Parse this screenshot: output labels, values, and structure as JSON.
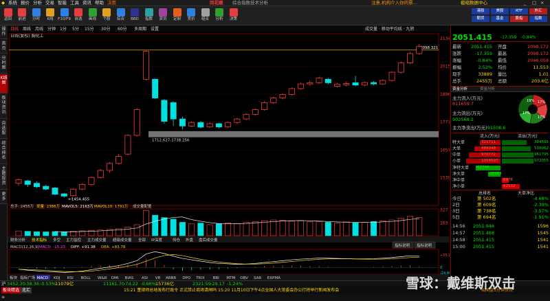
{
  "menu": [
    "系统",
    "报价",
    "分析",
    "交易",
    "智能",
    "工具",
    "资讯",
    "帮助",
    "决策"
  ],
  "menu_center": "综合指数技术分析",
  "menu_right": "注意,机构介入你的票...",
  "menu_right2": "截缩数据中心",
  "brand": "同花顺",
  "toolbar": [
    "返回",
    "前进",
    "分时",
    "K线",
    "F10/F9",
    "自选",
    "画线",
    "个股",
    "综合",
    "BBD",
    "指数",
    "资讯",
    "定制",
    "竞价",
    "组合",
    "分析",
    "决策"
  ],
  "toolbar_right": [
    "港股",
    "美股",
    "RTF",
    "外汇",
    "期货",
    "基金",
    "股指",
    "指数"
  ],
  "left_tabs": [
    "操作",
    "首页",
    "分时图",
    "K线图",
    "板块资讯",
    "自选股",
    "综合排名",
    "主题投资",
    "更多"
  ],
  "chart_header": {
    "period_tabs": [
      "日线",
      "周线",
      "月线",
      "分钟",
      "1分",
      "5分",
      "15分",
      "30分",
      "60分",
      "多周期",
      "设置"
    ],
    "stock_line": "日线(复权)  胸化工",
    "right_tools": "成交量 · 移动平均线 · 九转",
    "current_label": "2058.321"
  },
  "chart_data": {
    "type": "candlestick",
    "y_ticks": [
      2134,
      2015,
      1896,
      1777,
      1657,
      1539
    ],
    "ylim": [
      1420,
      2155
    ],
    "candles": [
      {
        "o": 1515,
        "c": 1530,
        "h": 1536,
        "l": 1505
      },
      {
        "o": 1525,
        "c": 1510,
        "h": 1530,
        "l": 1500
      },
      {
        "o": 1515,
        "c": 1500,
        "h": 1522,
        "l": 1495
      },
      {
        "o": 1502,
        "c": 1490,
        "h": 1508,
        "l": 1485
      },
      {
        "o": 1495,
        "c": 1468,
        "h": 1498,
        "l": 1463
      },
      {
        "o": 1470,
        "c": 1460,
        "h": 1473,
        "l": 1454
      },
      {
        "o": 1462,
        "c": 1490,
        "h": 1494,
        "l": 1458
      },
      {
        "o": 1490,
        "c": 1510,
        "h": 1515,
        "l": 1486
      },
      {
        "o": 1510,
        "c": 1540,
        "h": 1545,
        "l": 1506
      },
      {
        "o": 1540,
        "c": 1570,
        "h": 1576,
        "l": 1535
      },
      {
        "o": 1570,
        "c": 1600,
        "h": 1605,
        "l": 1560
      },
      {
        "o": 1600,
        "c": 1630,
        "h": 1640,
        "l": 1595
      },
      {
        "o": 1640,
        "c": 1720,
        "h": 1725,
        "l": 1635
      },
      {
        "o": 1720,
        "c": 1830,
        "h": 1836,
        "l": 1715
      },
      {
        "o": 1960,
        "c": 2080,
        "h": 2085,
        "l": 1955
      },
      {
        "o": 1960,
        "c": 1880,
        "h": 1965,
        "l": 1875
      },
      {
        "o": 1870,
        "c": 1780,
        "h": 1875,
        "l": 1770
      },
      {
        "o": 1860,
        "c": 1790,
        "h": 1866,
        "l": 1760
      },
      {
        "o": 1790,
        "c": 1760,
        "h": 1800,
        "l": 1745
      },
      {
        "o": 1760,
        "c": 1775,
        "h": 1780,
        "l": 1755
      },
      {
        "o": 1775,
        "c": 1755,
        "h": 1782,
        "l": 1750
      },
      {
        "o": 1756,
        "c": 1770,
        "h": 1775,
        "l": 1752
      },
      {
        "o": 1770,
        "c": 1756,
        "h": 1774,
        "l": 1750
      },
      {
        "o": 1756,
        "c": 1775,
        "h": 1780,
        "l": 1752
      },
      {
        "o": 1775,
        "c": 1790,
        "h": 1795,
        "l": 1770
      },
      {
        "o": 1790,
        "c": 1810,
        "h": 1815,
        "l": 1785
      },
      {
        "o": 1810,
        "c": 1830,
        "h": 1835,
        "l": 1805
      },
      {
        "o": 1830,
        "c": 1860,
        "h": 1866,
        "l": 1826
      },
      {
        "o": 1860,
        "c": 1880,
        "h": 1886,
        "l": 1855
      },
      {
        "o": 1880,
        "c": 1895,
        "h": 1900,
        "l": 1874
      },
      {
        "o": 1895,
        "c": 1920,
        "h": 1925,
        "l": 1890
      },
      {
        "o": 1920,
        "c": 1940,
        "h": 1946,
        "l": 1915
      },
      {
        "o": 1940,
        "c": 1945,
        "h": 1955,
        "l": 1932
      },
      {
        "o": 1945,
        "c": 1965,
        "h": 1972,
        "l": 1940
      },
      {
        "o": 1960,
        "c": 1945,
        "h": 1965,
        "l": 1938
      },
      {
        "o": 1930,
        "c": 1938,
        "h": 1944,
        "l": 1925
      },
      {
        "o": 1935,
        "c": 1942,
        "h": 1950,
        "l": 1930
      },
      {
        "o": 1945,
        "c": 1935,
        "h": 1975,
        "l": 1930
      },
      {
        "o": 1935,
        "c": 1946,
        "h": 1950,
        "l": 1930
      },
      {
        "o": 1946,
        "c": 1940,
        "h": 1952,
        "l": 1935
      },
      {
        "o": 1940,
        "c": 1955,
        "h": 1960,
        "l": 1936
      },
      {
        "o": 1955,
        "c": 1990,
        "h": 1995,
        "l": 1950
      },
      {
        "o": 1990,
        "c": 2030,
        "h": 2036,
        "l": 1985
      },
      {
        "o": 2030,
        "c": 2070,
        "h": 2076,
        "l": 2025
      },
      {
        "o": 2070,
        "c": 2100,
        "h": 2110,
        "l": 2066
      }
    ],
    "annotation_low": "1454.455",
    "annotation_high": "2098.321",
    "band_label": "1712.627-1738.256",
    "vol_header": {
      "total": "总手: 2455万",
      "now": "现量: 2386万",
      "ma5": "MAVOL5: 2163万",
      "ma10": "MAVOL10: 1791万",
      "extra": "成交量配置"
    },
    "vol_ticks": [
      327,
      163
    ],
    "volumes": [
      60,
      55,
      50,
      48,
      52,
      45,
      58,
      62,
      68,
      72,
      80,
      88,
      110,
      140,
      320,
      260,
      230,
      210,
      170,
      150,
      160,
      140,
      150,
      160,
      155,
      170,
      180,
      190,
      200,
      195,
      185,
      190,
      175,
      180,
      170,
      160,
      175,
      165,
      170,
      180,
      190,
      200,
      220,
      245,
      230
    ],
    "macd_header": {
      "name": "MACD(12,26,9)",
      "macd": "MACD: -15.23",
      "diff": "DIFF: +91.38",
      "dea": "DEA: +83.78"
    },
    "macd_ticks": [
      "+55.15",
      "0",
      "-24.40"
    ],
    "macd_values": [
      -8,
      -12,
      -15,
      -18,
      -20,
      -22,
      -20,
      -16,
      -10,
      -4,
      2,
      8,
      18,
      30,
      60,
      70,
      62,
      50,
      40,
      34,
      28,
      22,
      18,
      16,
      14,
      15,
      18,
      22,
      26,
      30,
      34,
      37,
      39,
      42,
      41,
      40,
      39,
      38,
      38,
      39,
      41,
      44,
      48,
      52,
      50
    ],
    "x_labels": [
      "2",
      "3",
      "5",
      "6",
      "7",
      "8",
      "9",
      "10",
      "11",
      "12",
      "13",
      "14",
      "16",
      "17",
      "20",
      "21",
      "22",
      "23",
      "24",
      "27",
      "28",
      "29",
      "30",
      "01",
      "02",
      "03",
      "04",
      "05",
      "06",
      "07",
      "08"
    ]
  },
  "indicator_tabs": [
    "财务分析",
    "技术指标",
    "多空",
    "主力监控",
    "主力成交量",
    "超级成交量",
    "全部",
    "IP深度",
    "持仓",
    "外盘",
    "盘后成交量"
  ],
  "macd_btns": [
    "指标说明",
    "指标说明"
  ],
  "sub_indicators": [
    "板块",
    "指标广场",
    "MACD",
    "KDJ",
    "RSI",
    "BOLL",
    "W&R",
    "DMI",
    "BIAS",
    "ASI",
    "VR",
    "ARBR",
    "DPO",
    "TRIX",
    "BBI",
    "MTM",
    "OBV",
    "SAR",
    "EXPMA"
  ],
  "sub_tabs": [
    "板块精选",
    "北汇"
  ],
  "quote": {
    "name": "胸化工",
    "code": "885863",
    "price": "2051.415",
    "change": "-17.359",
    "pct": "-0.84%",
    "rows": [
      {
        "l": "最新",
        "v": "2051.415",
        "l2": "开盘",
        "v2": "2098.172"
      },
      {
        "l": "涨跌",
        "v": "-17.359",
        "l2": "最高",
        "v2": "2098.172"
      },
      {
        "l": "涨幅",
        "v": "-0.84%",
        "l2": "最低",
        "v2": "2046.058"
      },
      {
        "l": "振幅",
        "v": "2.52%",
        "l2": "均价",
        "v2": "11.553"
      },
      {
        "l": "现手",
        "v": "33889",
        "l2": "量比",
        "v2": "1.01"
      },
      {
        "l": "总手",
        "v": "2455万",
        "l2": "总额",
        "v2": "203.6亿"
      }
    ],
    "fund_tabs": [
      "资金分析",
      "资金分析"
    ],
    "main_in_label": "主力流入(万元)",
    "main_in": "811659.7",
    "main_out_label": "主力流出(万元)",
    "main_out": "902568.2",
    "main_net_label": "主力净流出(万元)",
    "main_net": "91508.6",
    "pie_labels": [
      "19%",
      "17%",
      "17%",
      "17%"
    ],
    "flow_header": [
      "",
      "流入(万元)",
      "流出(万元)"
    ],
    "flow_rows": [
      {
        "l": "特大单",
        "a": "321711",
        "b": "384505"
      },
      {
        "l": "大单",
        "a": "489348",
        "b": "518062"
      },
      {
        "l": "中单",
        "a": "970772",
        "b": "961795"
      },
      {
        "l": "小单",
        "a": "1054597",
        "b": "972055"
      }
    ],
    "net_rows": [
      {
        "l": "净特大单",
        "v": "-62794"
      },
      {
        "l": "净大单",
        "v": "-28713"
      },
      {
        "l": "净中单",
        "v": "8976"
      },
      {
        "l": "净小单",
        "v": "82532"
      }
    ],
    "rank_header": [
      "",
      "总排名",
      "大单净比"
    ],
    "rank_rows": [
      {
        "l": "今日",
        "r": "第 502名",
        "p": "-4.68%"
      },
      {
        "l": "2日",
        "r": "第 609名",
        "p": "-2.39%"
      },
      {
        "l": "3日",
        "r": "第 738名",
        "p": "-3.57%"
      },
      {
        "l": "5日",
        "r": "第 694名",
        "p": "-1.91%"
      }
    ],
    "ticks": [
      {
        "t": "14:56",
        "p": "2051.946",
        "v": "1596"
      },
      {
        "t": "14:57",
        "p": "2051.488",
        "v": "1545"
      },
      {
        "t": "14:58",
        "p": "2051.415",
        "v": "1541"
      },
      {
        "t": "15:00",
        "p": "2051.415",
        "v": "1541"
      }
    ]
  },
  "status1": {
    "sh_label": "沪",
    "sh_val": "3452.30",
    "sh_chg": "-38.36",
    "sh_pct": "-0.53%",
    "sh_amt": "11079亿",
    "sz_val": "11161.70",
    "sz_chg": "-74.22",
    "sz_pct": "-0.66%",
    "sz_amt": "15736亿",
    "cy_val": "2321.59",
    "cy_chg": "-29.17",
    "cy_pct": "-1.24%"
  },
  "ticker": "15:21 董律师总地发布行政令 正式禁止商场清闸吗 15:20 11月10日下午4点全国人大常委会办公行将举行新闻发布会",
  "ticker_right": "私闻金3分钟快讯",
  "status3": [
    "创",
    "业",
    "",
    ""
  ],
  "watermark": "雪球：戴维斯双击"
}
